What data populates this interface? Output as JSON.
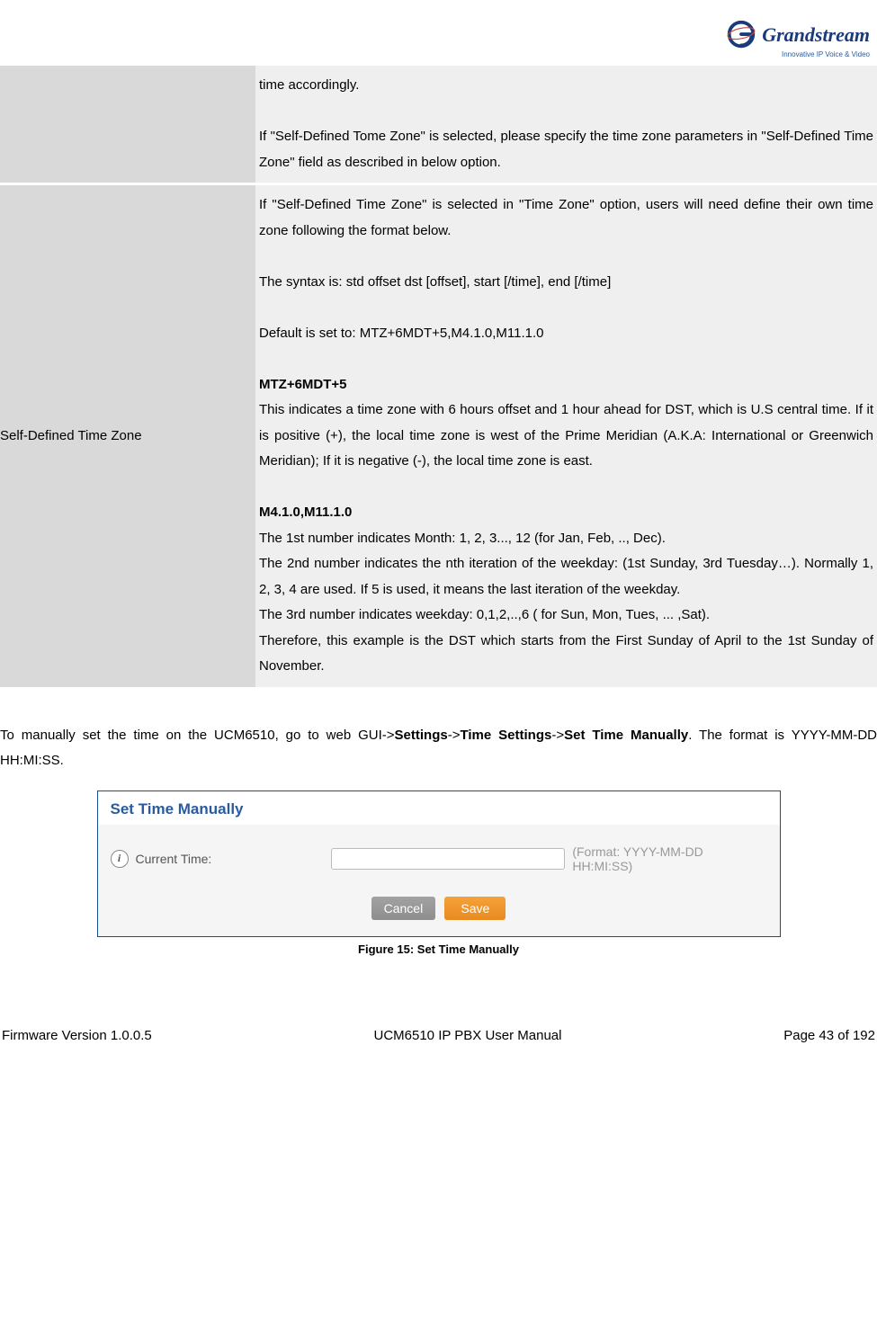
{
  "logo": {
    "brand": "Grandstream",
    "tagline": "Innovative IP Voice & Video"
  },
  "table": {
    "row1": {
      "label": "",
      "p1": "time accordingly.",
      "p2": "If \"Self-Defined Tome Zone\" is selected, please specify the time zone parameters in \"Self-Defined Time Zone\" field as described in below option."
    },
    "row2": {
      "label": "Self-Defined Time Zone",
      "p1": "If \"Self-Defined Time Zone\" is selected in \"Time Zone\" option, users will need define their own time zone following the format below.",
      "p2": "The syntax is: std offset dst [offset], start [/time], end [/time]",
      "p3": "Default is set to: MTZ+6MDT+5,M4.1.0,M11.1.0",
      "h1": "MTZ+6MDT+5",
      "p4": "This indicates a time zone with 6 hours offset and 1 hour ahead for DST, which is U.S central time. If it is positive (+), the local time zone is west of the Prime Meridian (A.K.A: International or Greenwich Meridian); If it is negative (-), the local time zone is east.",
      "h2": "M4.1.0,M11.1.0",
      "p5": "The 1st number indicates Month: 1, 2, 3..., 12 (for Jan, Feb, .., Dec).",
      "p6": "The 2nd number indicates the nth iteration of the weekday: (1st Sunday, 3rd Tuesday…). Normally 1, 2, 3, 4 are used. If 5 is used, it means the last iteration of the weekday.",
      "p7": "The 3rd number indicates weekday: 0,1,2,..,6 ( for Sun, Mon, Tues, ... ,Sat).",
      "p8": "Therefore, this example is the DST which starts from the First Sunday of April to the 1st Sunday of November."
    }
  },
  "paragraph": {
    "t1": "To manually set the time on the UCM6510, go to web GUI->",
    "b1": "Settings",
    "t2": "->",
    "b2": "Time Settings",
    "t3": "->",
    "b3": "Set Time Manually",
    "t4": ". The format is YYYY-MM-DD HH:MI:SS."
  },
  "panel": {
    "title": "Set Time Manually",
    "field_label": "Current Time:",
    "placeholder": "",
    "hint": "(Format: YYYY-MM-DD HH:MI:SS)",
    "cancel": "Cancel",
    "save": "Save"
  },
  "figure_caption": "Figure 15: Set Time Manually",
  "footer": {
    "left": "Firmware Version 1.0.0.5",
    "center": "UCM6510 IP PBX User Manual",
    "right": "Page 43 of 192"
  }
}
